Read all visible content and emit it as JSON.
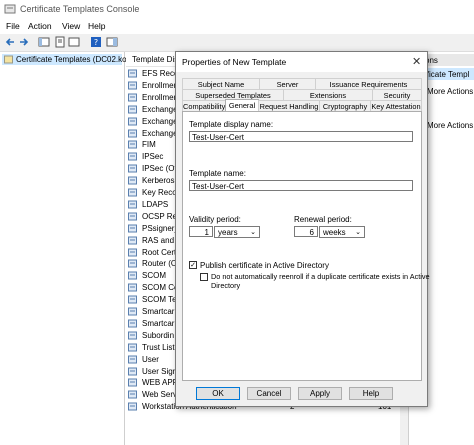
{
  "window": {
    "title": "Certificate Templates Console"
  },
  "menu": [
    "File",
    "Action",
    "View",
    "Help"
  ],
  "tree": {
    "selected": "Certificate Templates (DC02.kor..."
  },
  "list": {
    "header": "Template Dis",
    "rows": [
      "EFS Recov",
      "Enrollmer",
      "Enrollmer",
      "Exchange",
      "Exchange",
      "Exchange",
      "FIM",
      "IPSec",
      "IPSec (Off",
      "Kerberos",
      "Key Recov",
      "LDAPS",
      "OCSP Res",
      "PSsigner_",
      "RAS and",
      "Root Cert",
      "Router (O",
      "SCOM",
      "SCOM Ce",
      "SCOM Te",
      "Smartcar",
      "Smartcar",
      "Subordin",
      "Trust List",
      "User",
      "User Sign",
      "WEB APP",
      "Web Serv",
      "Workstation Authentication"
    ],
    "last_row_version": "2",
    "last_row_rev": "101"
  },
  "actions": {
    "header": "ons",
    "selected": "ificate Templ",
    "items": [
      "More Actions",
      "More Actions"
    ]
  },
  "dialog": {
    "title": "Properties of New Template",
    "tabs_row1": [
      "Subject Name",
      "Server",
      "Issuance Requirements"
    ],
    "tabs_row2": [
      "Superseded Templates",
      "Extensions",
      "Security"
    ],
    "tabs_row3": [
      "Compatibility",
      "General",
      "Request Handling",
      "Cryptography",
      "Key Attestation"
    ],
    "display_name_label": "Template display name:",
    "display_name_value": "Test-User-Cert",
    "name_label": "Template name:",
    "name_value": "Test-User-Cert",
    "validity_label": "Validity period:",
    "validity_num": "1",
    "validity_unit": "years",
    "renewal_label": "Renewal period:",
    "renewal_num": "6",
    "renewal_unit": "weeks",
    "publish_label": "Publish certificate in Active Directory",
    "reenroll_label_1": "Do not automatically reenroll if a duplicate certificate exists in Active",
    "reenroll_label_2": "Directory",
    "buttons": {
      "ok": "OK",
      "cancel": "Cancel",
      "apply": "Apply",
      "help": "Help"
    }
  }
}
